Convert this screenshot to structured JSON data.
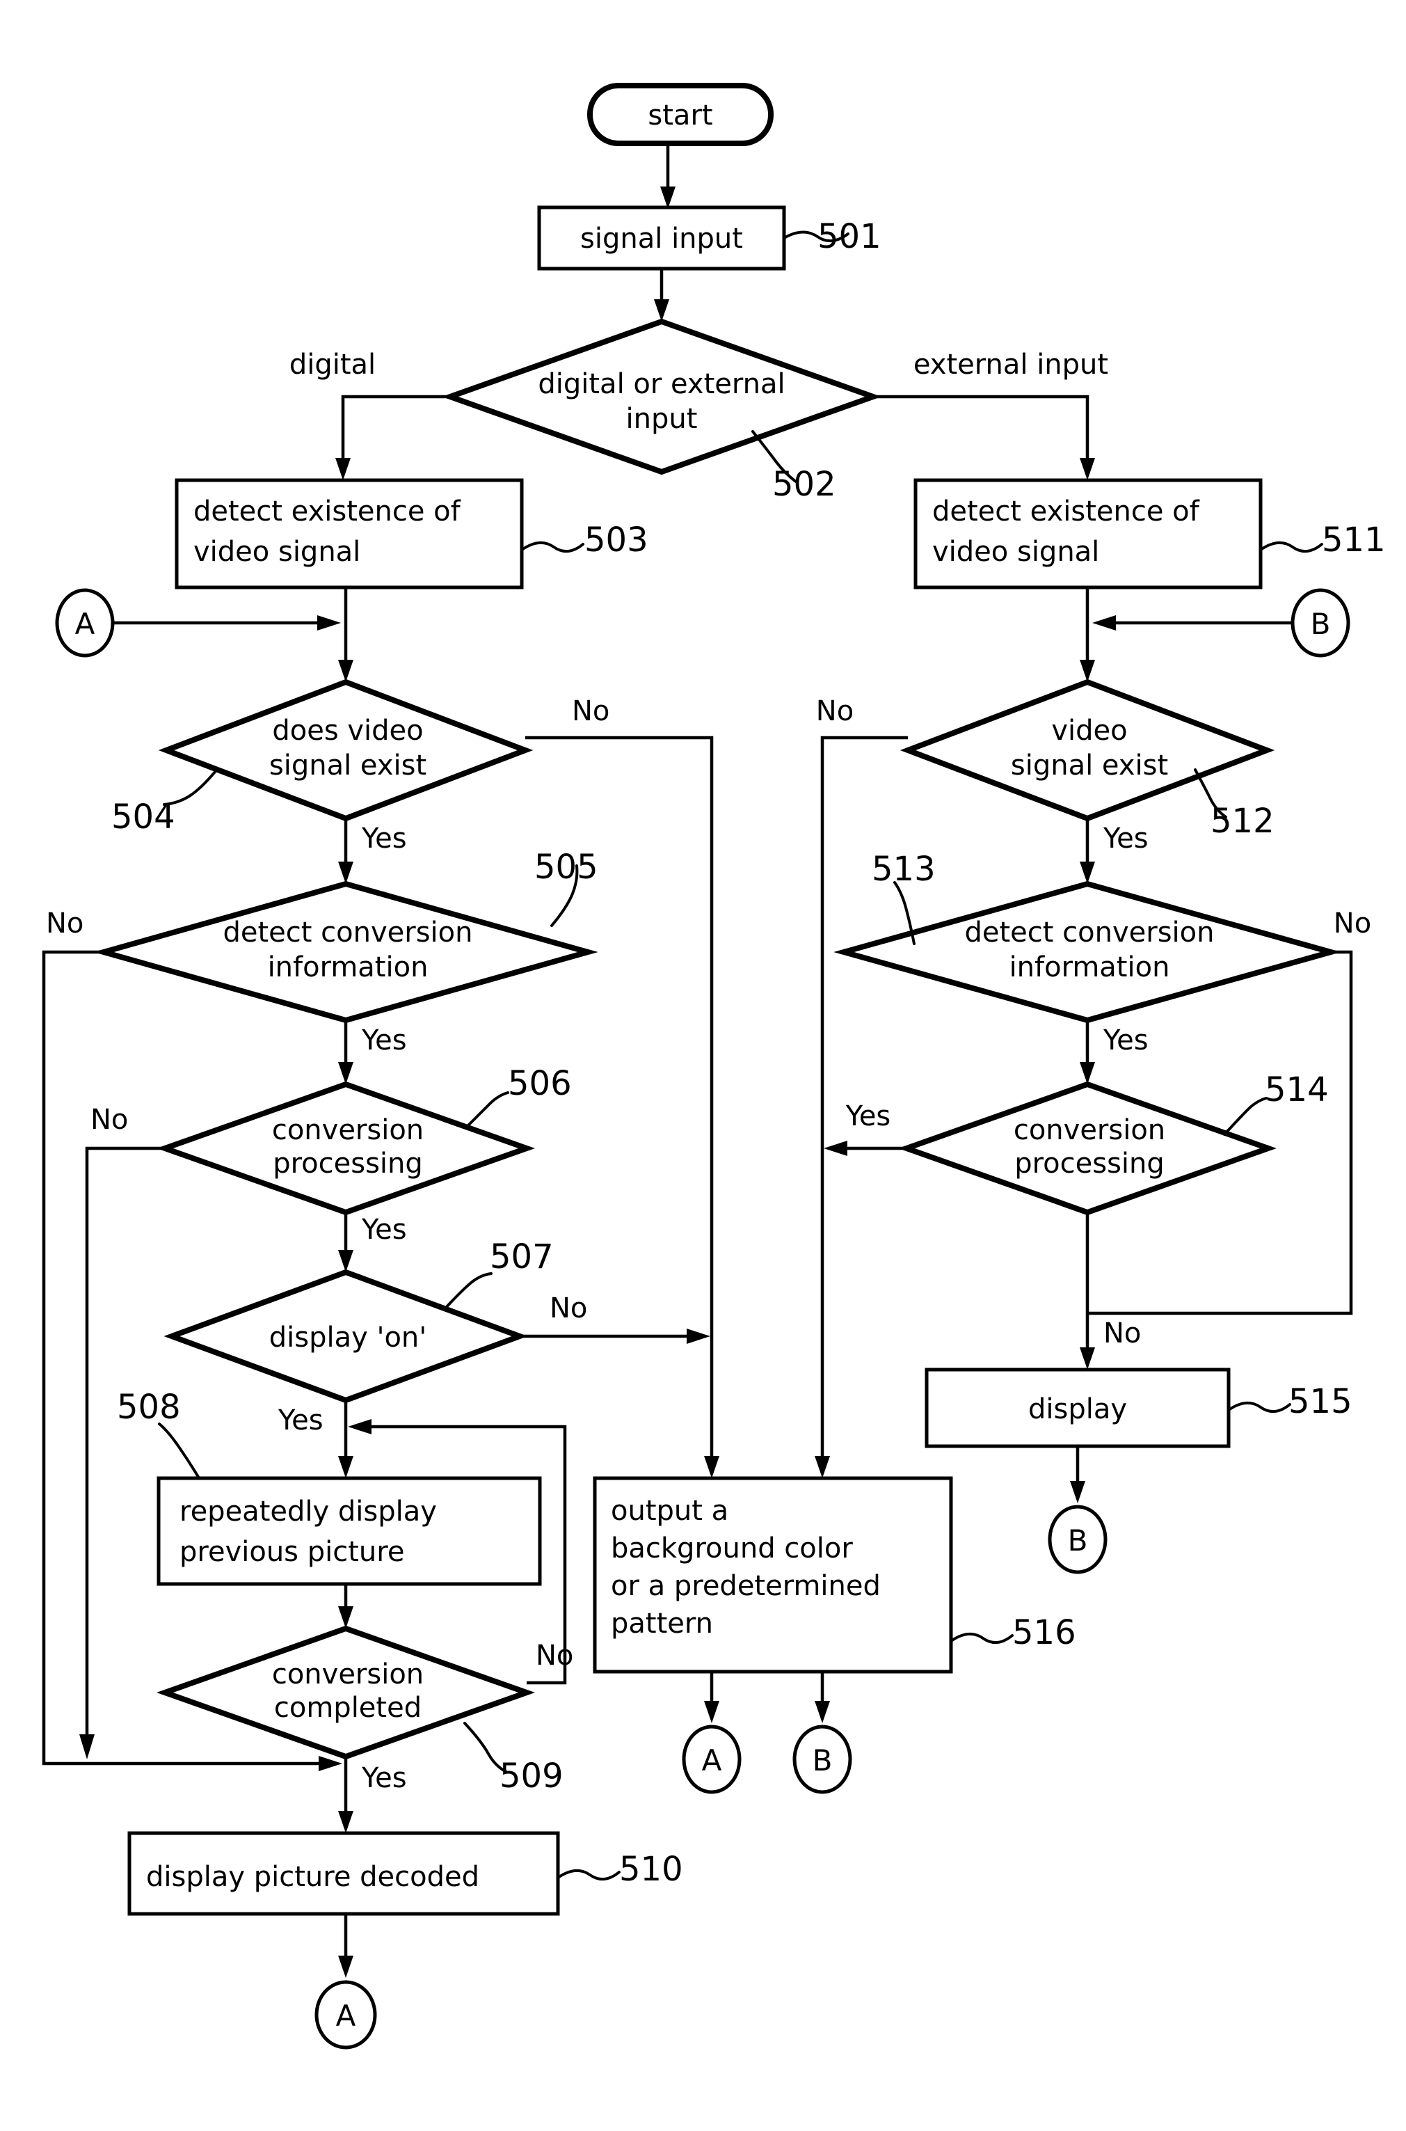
{
  "diagram": {
    "type": "flowchart",
    "title": "video signal display processing flowchart",
    "terminals": {
      "start": "start"
    },
    "nodes": [
      {
        "ref": "501",
        "shape": "process",
        "text": "signal  input"
      },
      {
        "ref": "502",
        "shape": "decision",
        "text_line1": "digital or external",
        "text_line2": "input"
      },
      {
        "ref": "503",
        "shape": "process",
        "text_line1": "detect existence of",
        "text_line2": "video signal"
      },
      {
        "ref": "504",
        "shape": "decision",
        "text_line1": "does video",
        "text_line2": "signal exist"
      },
      {
        "ref": "505",
        "shape": "decision",
        "text_line1": "detect conversion",
        "text_line2": "information"
      },
      {
        "ref": "506",
        "shape": "decision",
        "text_line1": "conversion",
        "text_line2": "processing"
      },
      {
        "ref": "507",
        "shape": "decision",
        "text_line1": "display 'on'",
        "text_line2": ""
      },
      {
        "ref": "508",
        "shape": "process",
        "text_line1": "repeatedly display",
        "text_line2": "previous picture"
      },
      {
        "ref": "509",
        "shape": "decision",
        "text_line1": "conversion",
        "text_line2": "completed"
      },
      {
        "ref": "510",
        "shape": "process",
        "text_line1": "display picture decoded",
        "text_line2": ""
      },
      {
        "ref": "511",
        "shape": "process",
        "text_line1": "detect existence of",
        "text_line2": "video signal"
      },
      {
        "ref": "512",
        "shape": "decision",
        "text_line1": "video",
        "text_line2": "signal exist"
      },
      {
        "ref": "513",
        "shape": "decision",
        "text_line1": "detect conversion",
        "text_line2": "information"
      },
      {
        "ref": "514",
        "shape": "decision",
        "text_line1": "conversion",
        "text_line2": "processing"
      },
      {
        "ref": "515",
        "shape": "process",
        "text_line1": "display",
        "text_line2": ""
      },
      {
        "ref": "516",
        "shape": "process",
        "text_line1": "output a",
        "text_line2": "background color",
        "text_line3": "or a predetermined",
        "text_line4": "pattern"
      }
    ],
    "edge_labels": {
      "digital": "digital",
      "external_input": "external  input",
      "no_504": "No",
      "yes_504": "Yes",
      "no_505": "No",
      "yes_505": "Yes",
      "no_506": "No",
      "yes_506": "Yes",
      "no_507": "No",
      "yes_507": "Yes",
      "no_509": "No",
      "yes_509": "Yes",
      "no_512": "No",
      "yes_512": "Yes",
      "no_513": "No",
      "yes_513": "Yes",
      "yes_514": "Yes",
      "no_514": "No"
    },
    "connectors": [
      {
        "id": "A",
        "label": "A",
        "position": "left-in-503"
      },
      {
        "id": "B",
        "label": "B",
        "position": "right-in-511"
      },
      {
        "id": "A2",
        "label": "A",
        "position": "below-516-left"
      },
      {
        "id": "B2",
        "label": "B",
        "position": "below-516-right"
      },
      {
        "id": "B3",
        "label": "B",
        "position": "below-515"
      },
      {
        "id": "A3",
        "label": "A",
        "position": "below-510"
      }
    ],
    "refs": {
      "r501": "501",
      "r502": "502",
      "r503": "503",
      "r504": "504",
      "r505": "505",
      "r506": "506",
      "r507": "507",
      "r508": "508",
      "r509": "509",
      "r510": "510",
      "r511": "511",
      "r512": "512",
      "r513": "513",
      "r514": "514",
      "r515": "515",
      "r516": "516"
    },
    "colors": {
      "stroke": "#000000",
      "background": "#ffffff"
    }
  }
}
